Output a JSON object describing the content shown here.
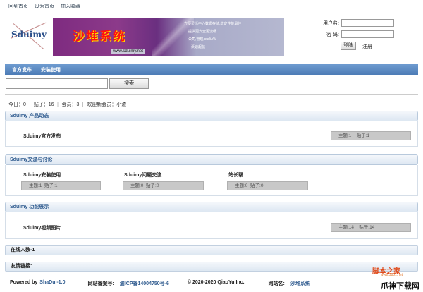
{
  "top_links": [
    "回到首页",
    "设为首页",
    "加入收藏"
  ],
  "logo": {
    "text": "Sduimy"
  },
  "banner": {
    "title": "沙堆系统",
    "url": "www.sduimy.net",
    "lines": [
      "方便灵活中心数据存储,稳定性能最佳",
      "提供更安全更流畅",
      "公司,管理,sudiu%",
      "沃速起航"
    ]
  },
  "login": {
    "username_label": "用户名:",
    "password_label": "密 码:",
    "login_button": "登陆",
    "register_link": "注册"
  },
  "nav": [
    "官方发布",
    "安装使用"
  ],
  "search": {
    "button": "搜索"
  },
  "stats": {
    "text": "今日：0 ｜ 贴子：16 ｜ 会员：3 ｜ 欢迎新会员：小渣 ｜"
  },
  "sections": [
    {
      "title": "Sduimy 产品动态",
      "forums": [
        {
          "name": "Sduimy官方发布",
          "stats": "主题:1    贴子:1"
        }
      ]
    },
    {
      "title": "Sduimy交流与讨论",
      "forums": [
        {
          "name": "Sduimy安装使用",
          "stats": "主题:1  贴子:1"
        },
        {
          "name": "Sduimy问题交流",
          "stats": "主题:0  贴子:0"
        },
        {
          "name": "站长帮",
          "stats": "主题:0  贴子:0"
        }
      ]
    },
    {
      "title": "Sduimy 功能展示",
      "forums": [
        {
          "name": "Sduimy视频图片",
          "stats": "主题:14    贴子:14"
        }
      ]
    }
  ],
  "online": "在线人数-1",
  "friend_links": "友情链接:",
  "footer": {
    "powered_prefix": "Powered by ",
    "powered_link": "ShaDui-1.0",
    "icp_label": "网站备案号:",
    "icp_value": "渝ICP备14004750号-6",
    "copyright": "© 2020-2020 QiaoYu Inc.",
    "site_label": "网站名:",
    "site_value": "沙堆系统"
  },
  "watermark": {
    "line1": "脚本之家",
    "line2": "www.Jb51.net",
    "line3": "爪神下载网"
  }
}
